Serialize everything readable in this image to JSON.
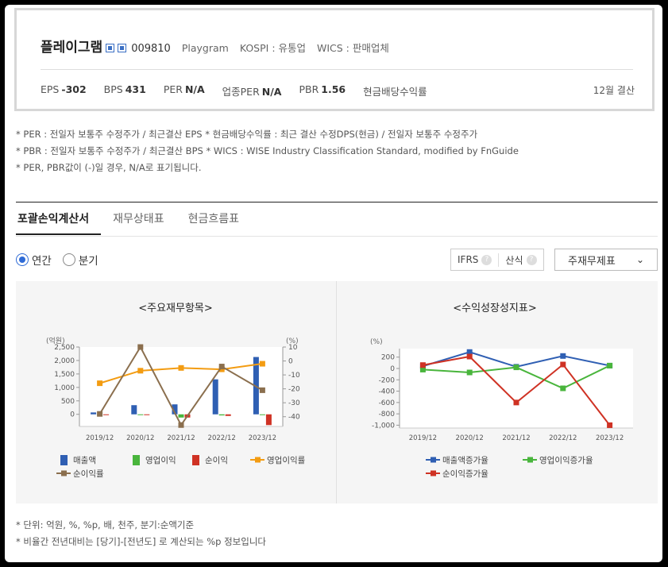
{
  "company": {
    "name": "플레이그램",
    "code": "009810",
    "english_name": "Playgram",
    "market": "KOSPI : 유통업",
    "wics": "WICS : 판매업체"
  },
  "metrics": [
    {
      "label": "EPS",
      "value": "-302"
    },
    {
      "label": "BPS",
      "value": "431"
    },
    {
      "label": "PER",
      "value": "N/A"
    },
    {
      "label": "업종PER",
      "value": "N/A"
    },
    {
      "label": "PBR",
      "value": "1.56"
    },
    {
      "label": "현금배당수익률",
      "value": ""
    }
  ],
  "fiscal_note": "12월 결산",
  "notes": [
    "* PER : 전일자 보통주 수정주가 / 최근결산 EPS * 현금배당수익률 : 최근 결산 수정DPS(현금) / 전일자 보통주 수정주가",
    "* PBR : 전일자 보통주 수정주가 / 최근결산 BPS * WICS : WISE Industry Classification Standard, modified by FnGuide",
    "* PER, PBR값이 (-)일 경우, N/A로 표기됩니다."
  ],
  "tabs": [
    "포괄손익계산서",
    "재무상태표",
    "현금흐름표"
  ],
  "period_options": [
    "연간",
    "분기"
  ],
  "toggles": {
    "ifrs": "IFRS",
    "calc": "산식",
    "help": "?"
  },
  "dropdown": {
    "selected": "주재무제표"
  },
  "footer_notes": [
    "* 단위: 억원, %, %p, 배, 천주, 분기:순액기준",
    "* 비율간 전년대비는 [당기]-[전년도] 로 계산되는 %p 정보입니다"
  ],
  "colors": {
    "blue": "#2f5fb3",
    "green": "#49b53c",
    "red": "#cf3224",
    "orange": "#f39c12",
    "brown": "#8b6f4e"
  },
  "chart_data": [
    {
      "type": "bar",
      "title": "<주요재무항목>",
      "categories": [
        "2019/12",
        "2020/12",
        "2021/12",
        "2022/12",
        "2023/12"
      ],
      "left_axis_label": "(억원)",
      "right_axis_label": "(%)",
      "left_ticks": [
        "2,500",
        "2,000",
        "1,500",
        "1,000",
        "500",
        "0"
      ],
      "right_ticks": [
        "10",
        "0",
        "-10",
        "-20",
        "-30",
        "-40"
      ],
      "ylim_left": [
        -450,
        2500
      ],
      "ylim_right": [
        -47,
        10
      ],
      "series": [
        {
          "name": "매출액",
          "kind": "bar",
          "axis": "left",
          "color": "#2f5fb3",
          "values": [
            70,
            340,
            370,
            1300,
            2130
          ]
        },
        {
          "name": "영업이익",
          "kind": "bar",
          "axis": "left",
          "color": "#49b53c",
          "values": [
            -10,
            -20,
            -120,
            -40,
            -30
          ]
        },
        {
          "name": "순이익",
          "kind": "bar",
          "axis": "left",
          "color": "#cf3224",
          "values": [
            -15,
            -5,
            -120,
            -60,
            -400
          ]
        },
        {
          "name": "영업이익률",
          "kind": "line",
          "axis": "right",
          "color": "#f39c12",
          "values": [
            -16,
            -7,
            -5,
            -6,
            -2
          ]
        },
        {
          "name": "순이익률",
          "kind": "line",
          "axis": "right",
          "color": "#8b6f4e",
          "values": [
            -38,
            10,
            -46,
            -4,
            -21
          ]
        }
      ]
    },
    {
      "type": "line",
      "title": "<수익성장성지표>",
      "categories": [
        "2019/12",
        "2020/12",
        "2021/12",
        "2022/12",
        "2023/12"
      ],
      "ylabel": "(%)",
      "ticks": [
        "200",
        "0",
        "-200",
        "-400",
        "-600",
        "-800",
        "-1,000"
      ],
      "ylim": [
        -1050,
        350
      ],
      "series": [
        {
          "name": "매출액증가율",
          "color": "#2f5fb3",
          "values": [
            40,
            290,
            30,
            220,
            50
          ]
        },
        {
          "name": "영업이익증가율",
          "color": "#49b53c",
          "values": [
            -20,
            -70,
            20,
            -350,
            50
          ]
        },
        {
          "name": "순이익증가율",
          "color": "#cf3224",
          "values": [
            60,
            210,
            -600,
            70,
            -1000
          ]
        }
      ]
    }
  ]
}
